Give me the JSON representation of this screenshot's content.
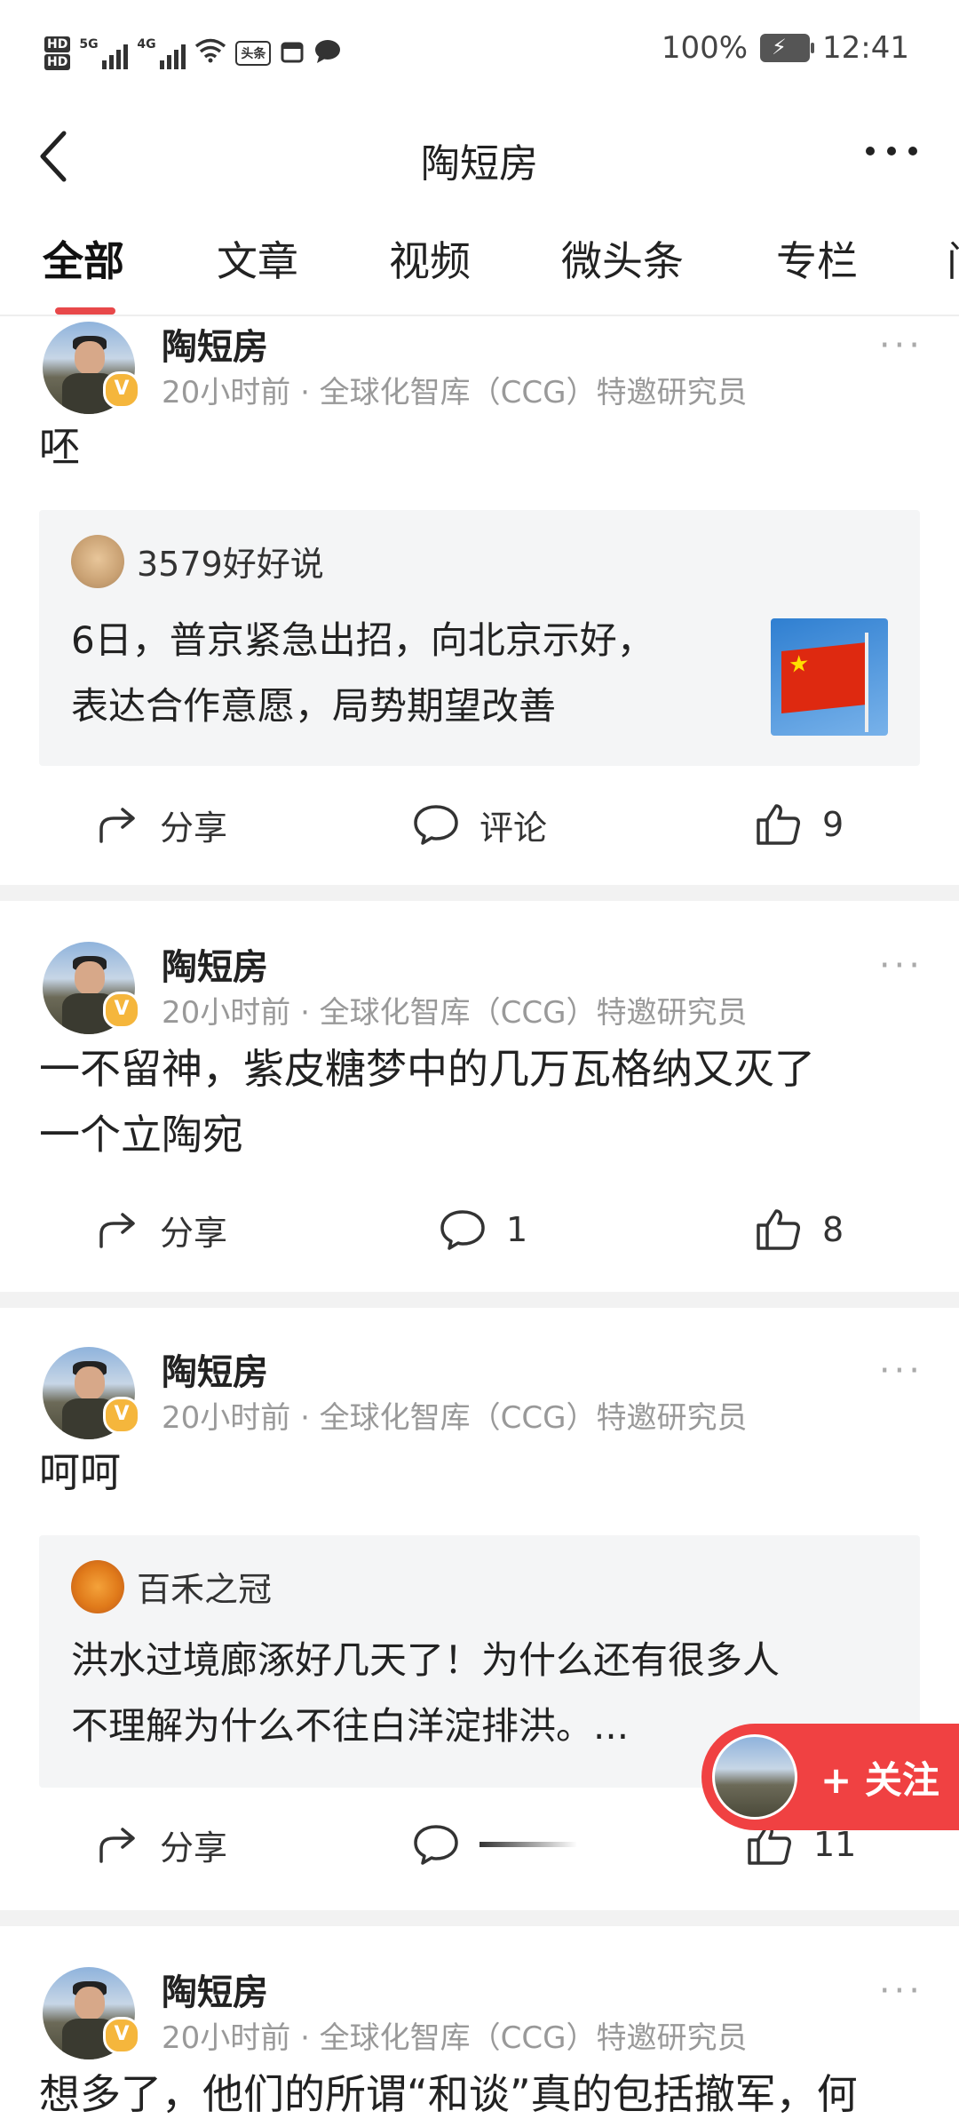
{
  "status_bar": {
    "sim1": "5G",
    "sim2": "4G",
    "hd1": "HD",
    "hd2": "HD",
    "news_badge": "头条",
    "battery": "100%",
    "time": "12:41",
    "icons": [
      "wifi-icon",
      "calendar-icon",
      "chat-bubble-icon"
    ]
  },
  "header": {
    "back_icon": "chevron-left-icon",
    "title": "陶短房",
    "more_icon": "more-horizontal-icon"
  },
  "tabs": [
    {
      "label": "全部",
      "active": true
    },
    {
      "label": "文章",
      "active": false
    },
    {
      "label": "视频",
      "active": false
    },
    {
      "label": "微头条",
      "active": false
    },
    {
      "label": "专栏",
      "active": false
    },
    {
      "label": "问",
      "active": false
    }
  ],
  "posts": [
    {
      "author": "陶短房",
      "meta": "20小时前 · 全球化智库（CCG）特邀研究员",
      "text": "呸",
      "quote": {
        "author": "3579好好说",
        "text_line1": "6日，普京紧急出招，向北京示好，",
        "text_line2": "表达合作意愿，局势期望改善",
        "thumbnail": "china-flag-image"
      },
      "share_label": "分享",
      "comment_label": "评论",
      "like_count": "9"
    },
    {
      "author": "陶短房",
      "meta": "20小时前 · 全球化智库（CCG）特邀研究员",
      "text_line1": "一不留神，紫皮糖梦中的几万瓦格纳又灭了",
      "text_line2": "一个立陶宛",
      "share_label": "分享",
      "comment_count": "1",
      "like_count": "8"
    },
    {
      "author": "陶短房",
      "meta": "20小时前 · 全球化智库（CCG）特邀研究员",
      "text": "呵呵",
      "quote": {
        "author": "百禾之冠",
        "text_line1": "洪水过境廊涿好几天了！为什么还有很多人",
        "text_line2": "不理解为什么不往白洋淀排洪。..."
      },
      "share_label": "分享",
      "like_count": "11"
    },
    {
      "author": "陶短房",
      "meta": "20小时前 · 全球化智库（CCG）特邀研究员",
      "text": "想多了，他们的所谓“和谈”真的包括撤军，何"
    }
  ],
  "follow_button": {
    "label": "+ 关注"
  },
  "colors": {
    "accent": "#f04142",
    "tab_underline": "#e8484a",
    "meta_gray": "#999999",
    "quote_bg": "#f4f5f6",
    "verified_badge": "#f5b63c"
  }
}
